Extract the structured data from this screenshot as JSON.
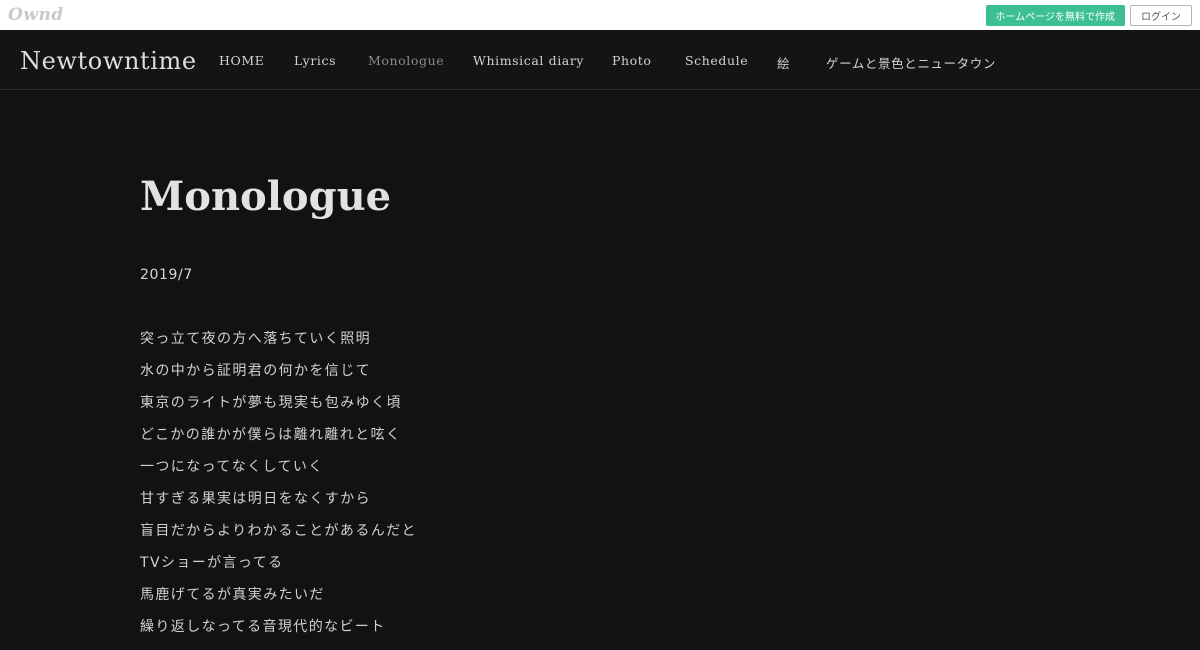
{
  "topbar": {
    "logo": "Ownd",
    "create_label": "ホームページを無料で作成",
    "login_label": "ログイン"
  },
  "header": {
    "site_title": "Newtowntime",
    "nav": [
      {
        "label": "HOME",
        "active": false
      },
      {
        "label": "Lyrics",
        "active": false
      },
      {
        "label": "Monologue",
        "active": true
      },
      {
        "label": "Whimsical diary",
        "active": false
      },
      {
        "label": "Photo",
        "active": false
      },
      {
        "label": "Schedule",
        "active": false
      },
      {
        "label": "絵",
        "active": false
      },
      {
        "label": "ゲームと景色とニュータウン",
        "active": false
      }
    ]
  },
  "main": {
    "title": "Monologue",
    "date": "2019/7",
    "lines": [
      "突っ立て夜の方へ落ちていく照明",
      "水の中から証明君の何かを信じて",
      "東京のライトが夢も現実も包みゆく頃",
      "どこかの誰かが僕らは離れ離れと呟く",
      "一つになってなくしていく",
      "甘すぎる果実は明日をなくすから",
      "盲目だからよりわかることがあるんだと",
      "TVショーが言ってる",
      "馬鹿げてるが真実みたいだ",
      "繰り返しなってる音現代的なビート"
    ]
  },
  "colors": {
    "background": "#121212",
    "accent": "#3cbf94"
  }
}
